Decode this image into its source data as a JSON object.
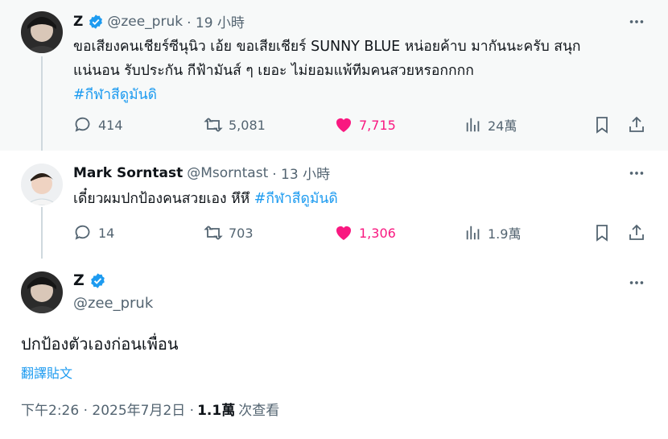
{
  "tweets": [
    {
      "name": "Z",
      "handle": "@zee_pruk",
      "time": "· 19 小時",
      "text_lines": [
        "ขอเสียงคนเชียร์ซีนุนิว เอ้ย ขอเสียเชียร์ SUNNY BLUE หน่อยค้าบ มากันนะครับ สนุก",
        "แน่นอน รับประกัน กีฟ้ามันส์ ๆ เยอะ ไม่ยอมแพ้ทีมคนสวยหรอกกกก"
      ],
      "hashtag": "#กีฬาสีดูมันดิ",
      "replies": "414",
      "reposts": "5,081",
      "likes": "7,715",
      "views": "24萬"
    },
    {
      "name": "Mark Sorntast",
      "handle": "@Msorntast",
      "time": "· 13 小時",
      "text": "เดี๋ยวผมปกป้องคนสวยเอง หึหึ ",
      "hashtag": "#กีฬาสีดูมันดิ",
      "replies": "14",
      "reposts": "703",
      "likes": "1,306",
      "views": "1.9萬"
    }
  ],
  "main_tweet": {
    "name": "Z",
    "handle": "@zee_pruk",
    "text": "ปกป้องตัวเองก่อนเพื่อน",
    "translate": "翻譯貼文",
    "timestamp": "下午2:26 · 2025年7月2日 ·",
    "views_count": "1.1萬",
    "views_label": "次查看"
  },
  "colors": {
    "accent": "#1d9bf0",
    "like": "#f91880",
    "muted": "#536471"
  }
}
